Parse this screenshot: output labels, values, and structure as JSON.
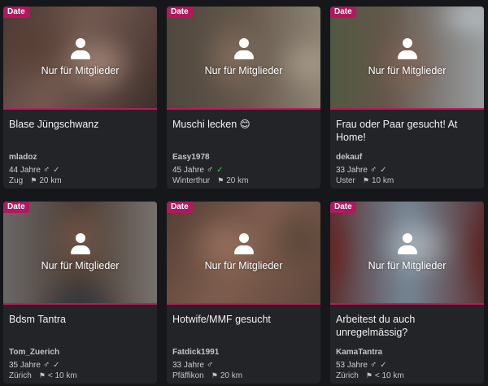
{
  "members_only_label": "Nur für Mitglieder",
  "badge_label": "Date",
  "colors": {
    "badge": "#b0195f",
    "accent_line": "#c2185b",
    "verified_green": "#43c25a"
  },
  "cards": [
    {
      "title": "Blase Jüngschwanz",
      "username": "mladoz",
      "age": "44 Jahre",
      "gender_icon": "male-icon",
      "verified": "check-gray",
      "city": "Zug",
      "distance": "20 km"
    },
    {
      "title": "Muschi lecken 😊",
      "username": "Easy1978",
      "age": "45 Jahre",
      "gender_icon": "male-icon",
      "verified": "check-green",
      "city": "Winterthur",
      "distance": "20 km"
    },
    {
      "title": "Frau oder Paar gesucht! At Home!",
      "username": "dekauf",
      "age": "33 Jahre",
      "gender_icon": "male-icon",
      "verified": "check-gray",
      "city": "Uster",
      "distance": "10 km"
    },
    {
      "title": "Bdsm Tantra",
      "username": "Tom_Zuerich",
      "age": "35 Jahre",
      "gender_icon": "male-icon",
      "verified": "check-gray",
      "city": "Zürich",
      "distance": "< 10 km"
    },
    {
      "title": "Hotwife/MMF gesucht",
      "username": "Fatdick1991",
      "age": "33 Jahre",
      "gender_icon": "male-icon",
      "verified": "",
      "city": "Pfäffikon",
      "distance": "20 km"
    },
    {
      "title": "Arbeitest du auch unregelmässig?",
      "username": "KamaTantra",
      "age": "53 Jahre",
      "gender_icon": "male-icon",
      "verified": "check-gray",
      "city": "Zürich",
      "distance": "< 10 km"
    }
  ]
}
